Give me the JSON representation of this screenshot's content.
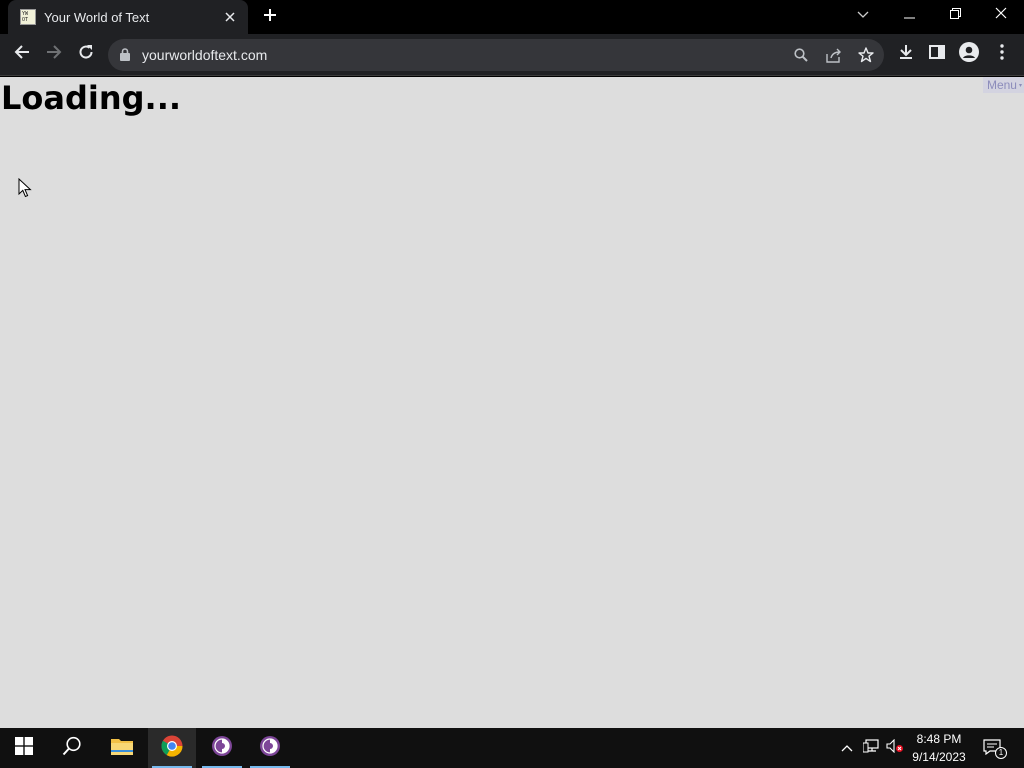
{
  "browser": {
    "tab": {
      "title": "Your World of Text",
      "favicon_text": "YW OT",
      "close_icon": "close-icon"
    },
    "new_tab_icon": "plus-icon",
    "window_controls": [
      "chevron-down-icon",
      "minimize-icon",
      "restore-icon",
      "close-icon"
    ],
    "toolbar": {
      "url": "yourworldoftext.com",
      "icons": [
        "back-arrow-icon",
        "forward-arrow-icon",
        "reload-icon",
        "lock-icon",
        "search-icon",
        "share-icon",
        "star-icon",
        "download-icon",
        "side-panel-icon",
        "profile-icon",
        "kebab-menu-icon"
      ]
    }
  },
  "page": {
    "loading_text": "Loading...",
    "menu_label": "Menu",
    "menu_arrow": "▾",
    "background": "#dddddd"
  },
  "taskbar": {
    "apps": [
      "windows-start-icon",
      "search-icon",
      "file-explorer-icon",
      "chrome-icon",
      "tor-browser-icon",
      "tor-browser-icon"
    ],
    "tray_icons": [
      "chevron-up-icon",
      "network-icon",
      "volume-muted-icon"
    ],
    "time": "8:48 PM",
    "date": "9/14/2023",
    "notification_count": "1"
  },
  "colors": {
    "tab_bg": "#202124",
    "taskbar_bg": "#101010",
    "accent": "#76b9ed"
  }
}
